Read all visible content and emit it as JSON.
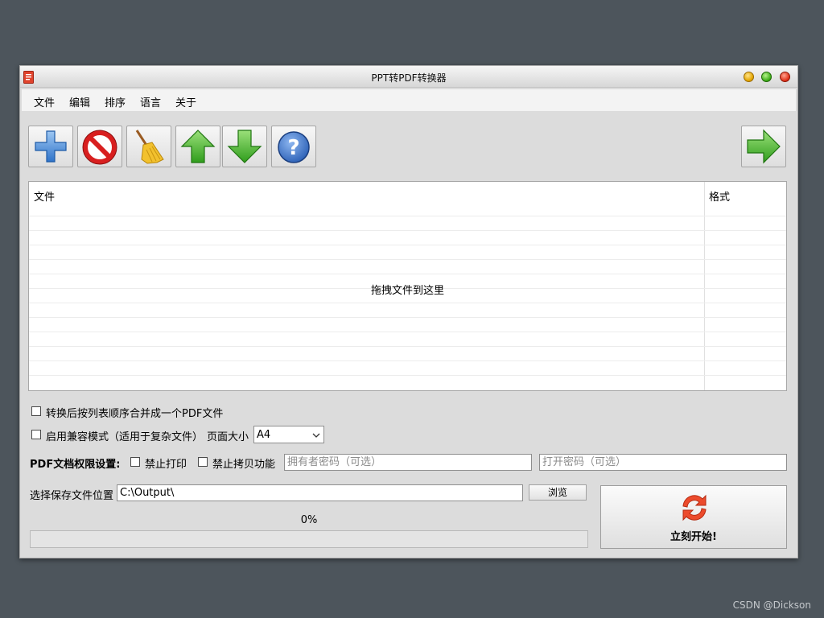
{
  "window": {
    "title": "PPT转PDF转换器"
  },
  "menu": {
    "items": [
      "文件",
      "编辑",
      "排序",
      "语言",
      "关于"
    ]
  },
  "toolbar": {
    "buttons": [
      "add-icon",
      "remove-icon",
      "clear-broom-icon",
      "move-up-icon",
      "move-down-icon",
      "help-icon"
    ],
    "next": "arrow-right-icon"
  },
  "file_list": {
    "columns": [
      "文件",
      "格式"
    ],
    "rows": [],
    "empty_hint": "拖拽文件到这里"
  },
  "options": {
    "merge_label": "转换后按列表顺序合并成一个PDF文件",
    "merge_checked": false,
    "compat_label": "启用兼容模式（适用于复杂文件）",
    "compat_checked": false,
    "page_size_label": "页面大小",
    "page_size_value": "A4"
  },
  "permissions": {
    "label": "PDF文档权限设置:",
    "no_print_label": "禁止打印",
    "no_print_checked": false,
    "no_copy_label": "禁止拷贝功能",
    "no_copy_checked": false,
    "owner_password_placeholder": "拥有者密码（可选）",
    "open_password_placeholder": "打开密码（可选）"
  },
  "output": {
    "label": "选择保存文件位置",
    "path": "C:\\Output\\",
    "browse_label": "浏览"
  },
  "progress": {
    "text": "0%",
    "value": 0
  },
  "start": {
    "label": "立刻开始!",
    "icon": "refresh-icon"
  },
  "watermark": "CSDN @Dickson",
  "colors": {
    "desktop": "#4d555c",
    "window": "#dcdcdc",
    "accent_red": "#e8452a",
    "accent_green": "#3fae1a"
  }
}
